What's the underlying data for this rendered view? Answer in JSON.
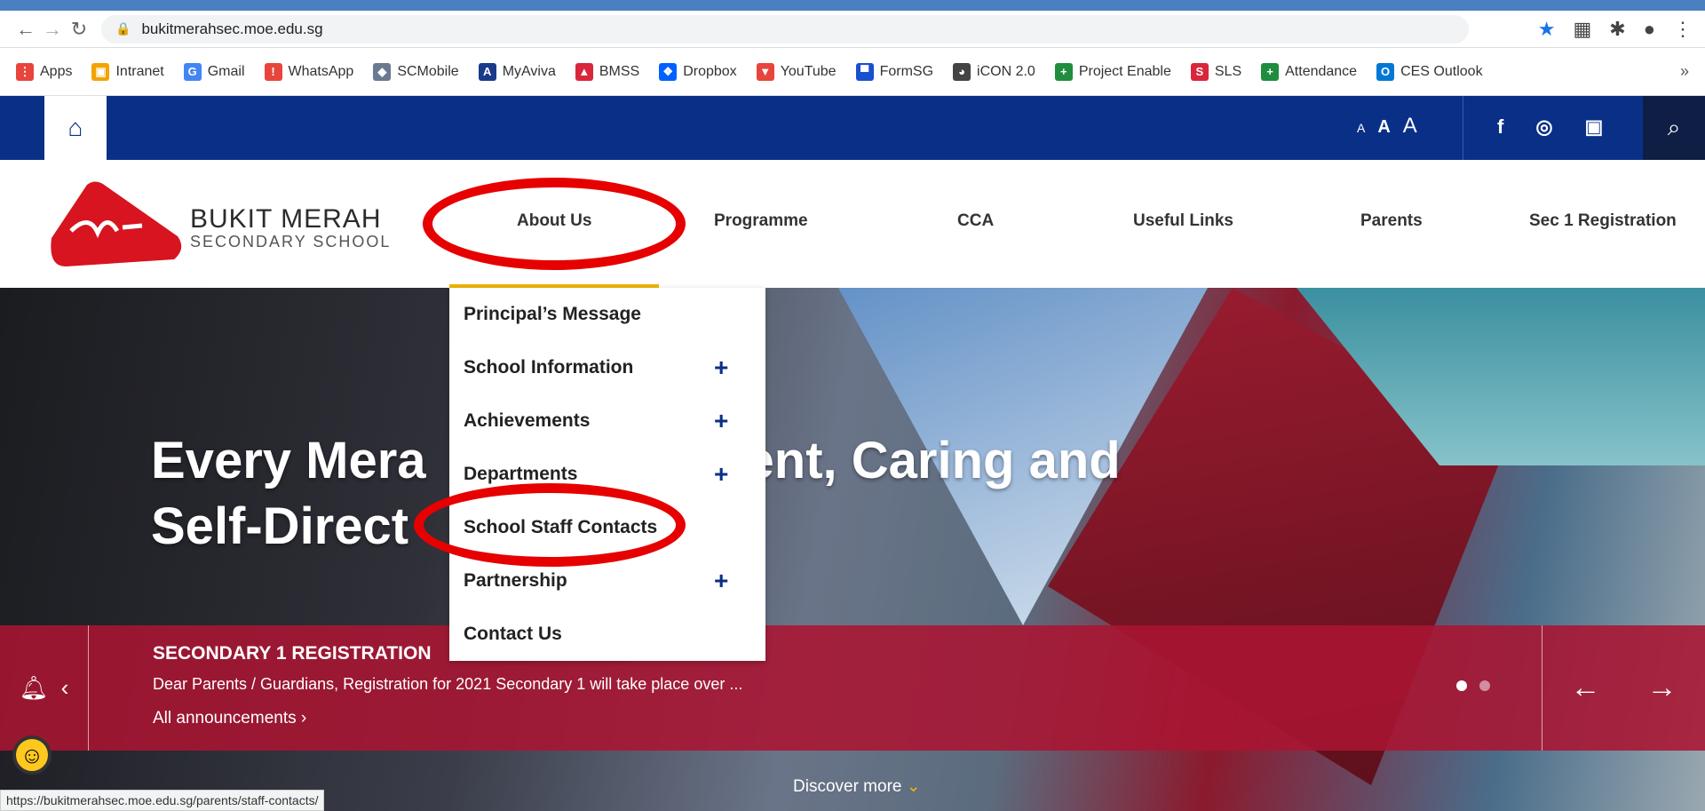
{
  "browser": {
    "url": "bukitmerahsec.moe.edu.sg",
    "status_url": "https://bukitmerahsec.moe.edu.sg/parents/staff-contacts/",
    "bookmarks": [
      {
        "label": "Apps",
        "color": "#e8453c",
        "glyph": "⋮"
      },
      {
        "label": "Intranet",
        "color": "#f4a300",
        "glyph": "▣"
      },
      {
        "label": "Gmail",
        "color": "#4285f4",
        "glyph": "G"
      },
      {
        "label": "WhatsApp",
        "color": "#e8453c",
        "glyph": "!"
      },
      {
        "label": "SCMobile",
        "color": "#6a7a90",
        "glyph": "◆"
      },
      {
        "label": "MyAviva",
        "color": "#1a3a8a",
        "glyph": "A"
      },
      {
        "label": "BMSS",
        "color": "#d9263a",
        "glyph": "▲"
      },
      {
        "label": "Dropbox",
        "color": "#0061fe",
        "glyph": "❖"
      },
      {
        "label": "YouTube",
        "color": "#e8453c",
        "glyph": "▼"
      },
      {
        "label": "FormSG",
        "color": "#1a4fd0",
        "glyph": "▀"
      },
      {
        "label": "iCON 2.0",
        "color": "#444",
        "glyph": "◕"
      },
      {
        "label": "Project Enable",
        "color": "#1e8e3e",
        "glyph": "+"
      },
      {
        "label": "SLS",
        "color": "#d9263a",
        "glyph": "S"
      },
      {
        "label": "Attendance",
        "color": "#1e8e3e",
        "glyph": "+"
      },
      {
        "label": "CES Outlook",
        "color": "#0078d4",
        "glyph": "O"
      }
    ],
    "more_glyph": "»"
  },
  "site": {
    "font_sizes": [
      "A",
      "A",
      "A"
    ],
    "school_line1": "BUKIT MERAH",
    "school_line2": "SECONDARY SCHOOL",
    "menu": [
      "About Us",
      "Programme",
      "CCA",
      "Useful Links",
      "Parents",
      "Sec 1 Registration"
    ],
    "dropdown": [
      {
        "label": "Principal’s Message",
        "plus": false
      },
      {
        "label": "School Information",
        "plus": true
      },
      {
        "label": "Achievements",
        "plus": true
      },
      {
        "label": "Departments",
        "plus": true
      },
      {
        "label": "School Staff Contacts",
        "plus": false
      },
      {
        "label": "Partnership",
        "plus": true
      },
      {
        "label": "Contact Us",
        "plus": false
      }
    ],
    "headline_line1": "Every Mera",
    "headline_line1_tail": "ent, Caring and",
    "headline_line2": "Self-Direct",
    "announcement": {
      "title": "SECONDARY 1 REGISTRATION",
      "text": "Dear Parents / Guardians, Registration for 2021 Secondary 1 will take place over ...",
      "all_link": "All announcements  ›"
    },
    "discover": "Discover more",
    "accent": "#f0b400",
    "brand_blue": "#0a2f86",
    "annotation_red": "#e60000"
  }
}
